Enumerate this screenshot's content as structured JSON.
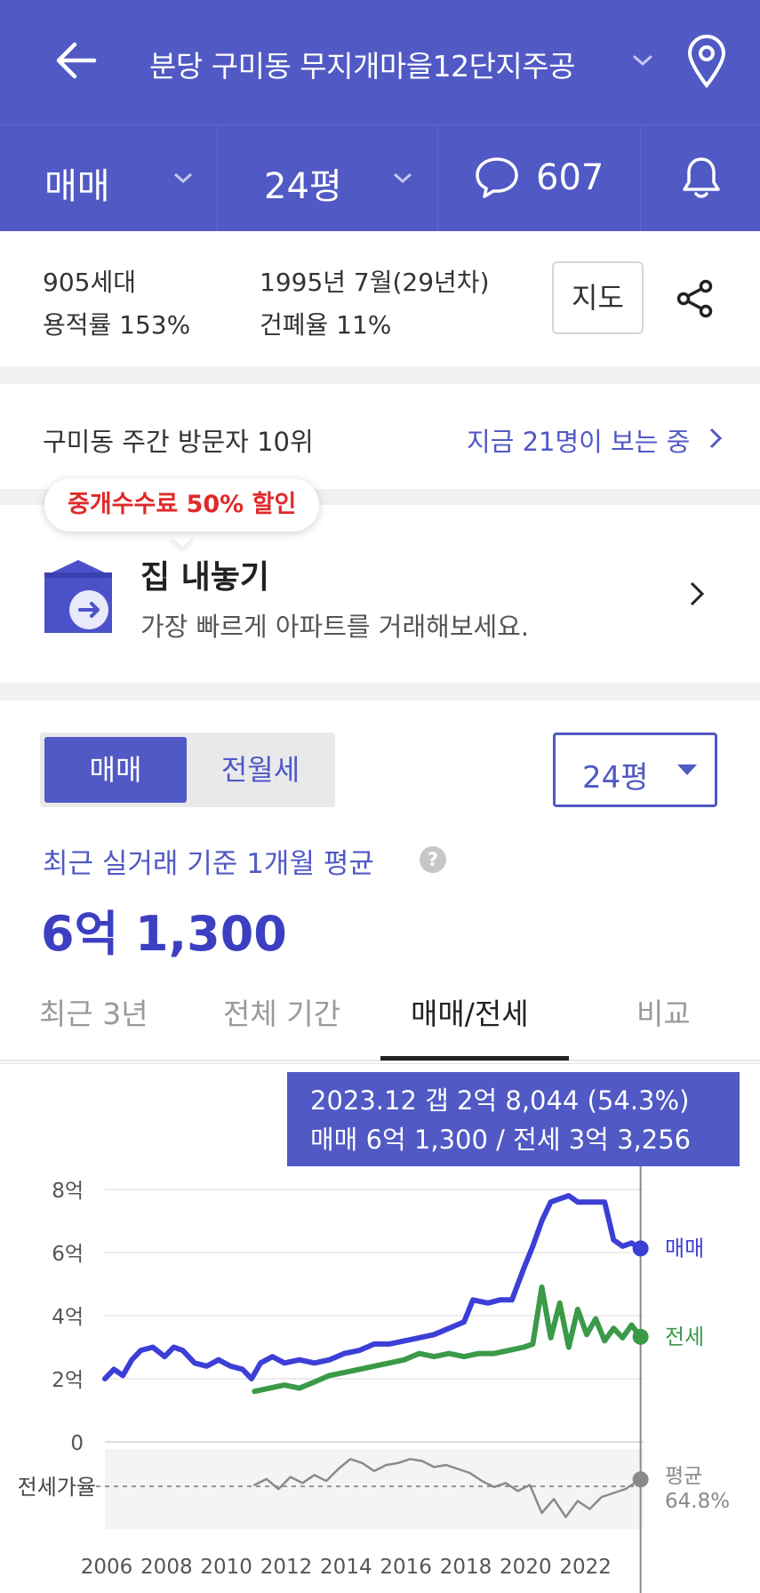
{
  "header": {
    "title": "분당 구미동 무지개마을12단지주공",
    "deal_type": "매매",
    "size": "24평",
    "comments": "607"
  },
  "info": {
    "households": "905세대",
    "floor_area_ratio": "용적률 153%",
    "built": "1995년 7월(29년차)",
    "coverage_ratio": "건폐율 11%",
    "map_button": "지도"
  },
  "visitors": {
    "rank": "구미동 주간 방문자 10위",
    "watching": "지금 21명이 보는 중"
  },
  "sell": {
    "badge": "중개수수료 50% 할인",
    "title": "집 내놓기",
    "subtitle": "가장 빠르게 아파트를 거래해보세요."
  },
  "price": {
    "toggle_active": "매매",
    "toggle_inactive": "전월세",
    "size_select": "24평",
    "avg_label": "최근 실거래 기준 1개월 평균",
    "avg_value": "6억 1,300"
  },
  "tabs": [
    "최근 3년",
    "전체 기간",
    "매매/전세",
    "비교"
  ],
  "tooltip": {
    "line1": "2023.12  갭 2억 8,044 (54.3%)",
    "line2": "매매 6억 1,300 / 전세 3억 3,256"
  },
  "colors": {
    "brand": "#5059c4",
    "sale": "#3c3fd6",
    "jeonse": "#3a9a48",
    "ratio": "#8a8a8a"
  },
  "chart_data": {
    "type": "line",
    "ylim": [
      0,
      8
    ],
    "y_ticks": [
      "0",
      "2억",
      "4억",
      "6억",
      "8억"
    ],
    "x_ticks": [
      "2006",
      "2008",
      "2010",
      "2012",
      "2014",
      "2016",
      "2018",
      "2020",
      "2022"
    ],
    "ratio_label": "전세가율",
    "series": [
      {
        "name": "매매",
        "color": "#3c3fd6",
        "x": [
          2006.0,
          2006.3,
          2006.6,
          2006.9,
          2007.2,
          2007.6,
          2008.0,
          2008.3,
          2008.6,
          2009.0,
          2009.4,
          2009.8,
          2010.2,
          2010.6,
          2010.9,
          2011.2,
          2011.6,
          2012.0,
          2012.5,
          2013.0,
          2013.5,
          2014.0,
          2014.5,
          2015.0,
          2015.5,
          2016.0,
          2016.5,
          2017.0,
          2017.5,
          2018.0,
          2018.3,
          2018.8,
          2019.2,
          2019.6,
          2020.0,
          2020.3,
          2020.6,
          2020.9,
          2021.2,
          2021.5,
          2021.8,
          2022.1,
          2022.4,
          2022.7,
          2023.0,
          2023.3,
          2023.6,
          2023.9
        ],
        "values": [
          2.0,
          2.3,
          2.1,
          2.6,
          2.9,
          3.0,
          2.7,
          3.0,
          2.9,
          2.5,
          2.4,
          2.6,
          2.4,
          2.3,
          2.0,
          2.5,
          2.7,
          2.5,
          2.6,
          2.5,
          2.6,
          2.8,
          2.9,
          3.1,
          3.1,
          3.2,
          3.3,
          3.4,
          3.6,
          3.8,
          4.5,
          4.4,
          4.5,
          4.5,
          5.5,
          6.2,
          7.0,
          7.6,
          7.7,
          7.8,
          7.6,
          7.6,
          7.6,
          7.6,
          6.4,
          6.2,
          6.3,
          6.13
        ]
      },
      {
        "name": "전세",
        "color": "#3a9a48",
        "x": [
          2011.0,
          2011.5,
          2012.0,
          2012.5,
          2013.0,
          2013.5,
          2014.0,
          2014.5,
          2015.0,
          2015.5,
          2016.0,
          2016.5,
          2017.0,
          2017.5,
          2018.0,
          2018.5,
          2019.0,
          2019.5,
          2020.0,
          2020.3,
          2020.6,
          2020.9,
          2021.2,
          2021.5,
          2021.8,
          2022.1,
          2022.4,
          2022.7,
          2023.0,
          2023.3,
          2023.6,
          2023.9
        ],
        "values": [
          1.6,
          1.7,
          1.8,
          1.7,
          1.9,
          2.1,
          2.2,
          2.3,
          2.4,
          2.5,
          2.6,
          2.8,
          2.7,
          2.8,
          2.7,
          2.8,
          2.8,
          2.9,
          3.0,
          3.1,
          4.9,
          3.3,
          4.4,
          3.0,
          4.2,
          3.4,
          3.9,
          3.2,
          3.6,
          3.3,
          3.7,
          3.33
        ]
      },
      {
        "name": "전세가율",
        "color": "#8a8a8a",
        "x": [
          2011.0,
          2011.4,
          2011.8,
          2012.2,
          2012.6,
          2013.0,
          2013.4,
          2013.8,
          2014.2,
          2014.6,
          2015.0,
          2015.4,
          2015.8,
          2016.2,
          2016.6,
          2017.0,
          2017.4,
          2017.8,
          2018.2,
          2018.6,
          2019.0,
          2019.4,
          2019.8,
          2020.2,
          2020.6,
          2021.0,
          2021.4,
          2021.8,
          2022.2,
          2022.6,
          2023.0,
          2023.4,
          2023.9
        ],
        "values": [
          62,
          65,
          60,
          66,
          63,
          67,
          64,
          70,
          75,
          73,
          69,
          72,
          73,
          75,
          74,
          71,
          72,
          70,
          68,
          64,
          61,
          63,
          59,
          62,
          48,
          55,
          46,
          54,
          50,
          56,
          58,
          60,
          64.8
        ]
      }
    ],
    "labels": {
      "sale": "매매",
      "jeonse": "전세",
      "avg_title": "평균",
      "avg_value": "64.8%"
    }
  }
}
